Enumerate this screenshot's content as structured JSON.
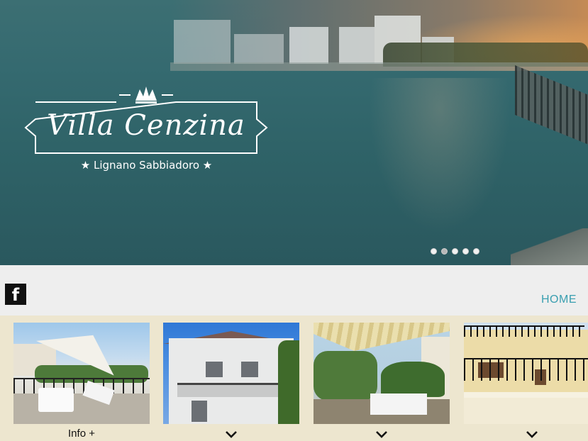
{
  "hero": {
    "title": "Villa Cenzina",
    "subtitle": "★ Lignano Sabbiadoro ★",
    "slides": 5,
    "active_slide": 2
  },
  "nav": {
    "facebook_icon": "facebook-icon",
    "facebook_glyph": "f",
    "home_label": "HOME"
  },
  "gallery": {
    "cards": [
      {
        "image": "terrace-umbrella-photo",
        "label": "Info +"
      },
      {
        "image": "white-house-photo",
        "label": ""
      },
      {
        "image": "balcony-awning-photo",
        "label": ""
      },
      {
        "image": "yellow-building-photo",
        "label": ""
      }
    ]
  },
  "colors": {
    "home_link": "#3a9fb0",
    "gallery_bg": "#ede6cf",
    "nav_bg": "#eeeeee"
  }
}
